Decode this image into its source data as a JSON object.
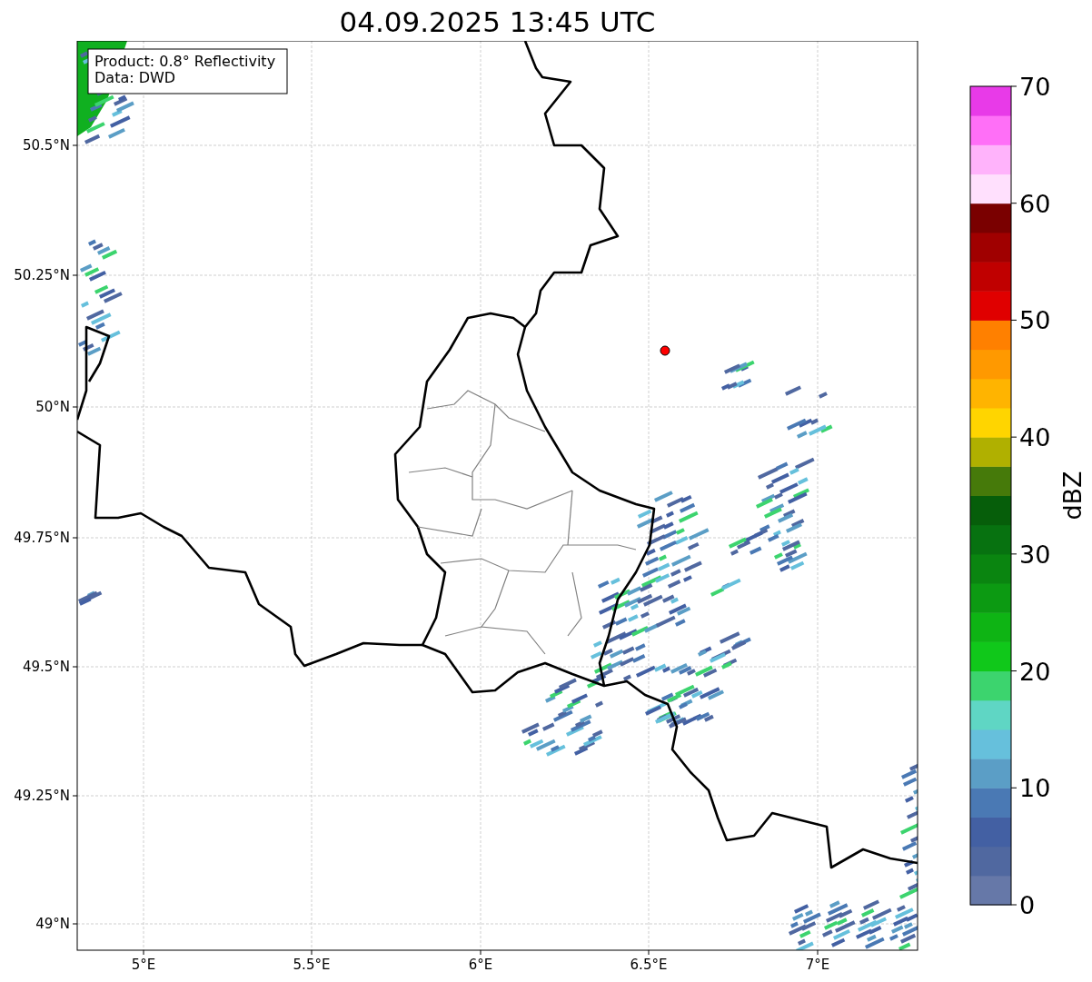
{
  "title": "04.09.2025 13:45 UTC",
  "map": {
    "info_lines": [
      "Product: 0.8° Reflectivity",
      "Data: DWD"
    ],
    "lat_labels": [
      "50.5°N",
      "50.25°N",
      "50°N",
      "49.75°N",
      "49.5°N",
      "49.25°N",
      "49°N"
    ],
    "lon_labels": [
      "5°E",
      "5.5°E",
      "6°E",
      "6.5°E",
      "7°E"
    ]
  },
  "colorbar": {
    "label": "dBZ",
    "ticks": [
      "70",
      "60",
      "50",
      "40",
      "30",
      "20",
      "10",
      "0"
    ],
    "bins": [
      {
        "color": "#6678a8"
      },
      {
        "color": "#5068a0"
      },
      {
        "color": "#4360a3"
      },
      {
        "color": "#4a79b4"
      },
      {
        "color": "#5b9ec6"
      },
      {
        "color": "#66c0dc"
      },
      {
        "color": "#5fd6c4"
      },
      {
        "color": "#3cd46e"
      },
      {
        "color": "#10c81a"
      },
      {
        "color": "#0eb414"
      },
      {
        "color": "#0c9a12"
      },
      {
        "color": "#0a8510"
      },
      {
        "color": "#077210"
      },
      {
        "color": "#065e0a"
      },
      {
        "color": "#467a0a"
      },
      {
        "color": "#b0b000"
      },
      {
        "color": "#ffd500"
      },
      {
        "color": "#ffb400"
      },
      {
        "color": "#ff9900"
      },
      {
        "color": "#ff8000"
      },
      {
        "color": "#e00000"
      },
      {
        "color": "#c00000"
      },
      {
        "color": "#a00000"
      },
      {
        "color": "#7a0000"
      },
      {
        "color": "#ffe0fd"
      },
      {
        "color": "#ffb3fb"
      },
      {
        "color": "#ff6ff7"
      },
      {
        "color": "#e83ae8"
      }
    ]
  }
}
